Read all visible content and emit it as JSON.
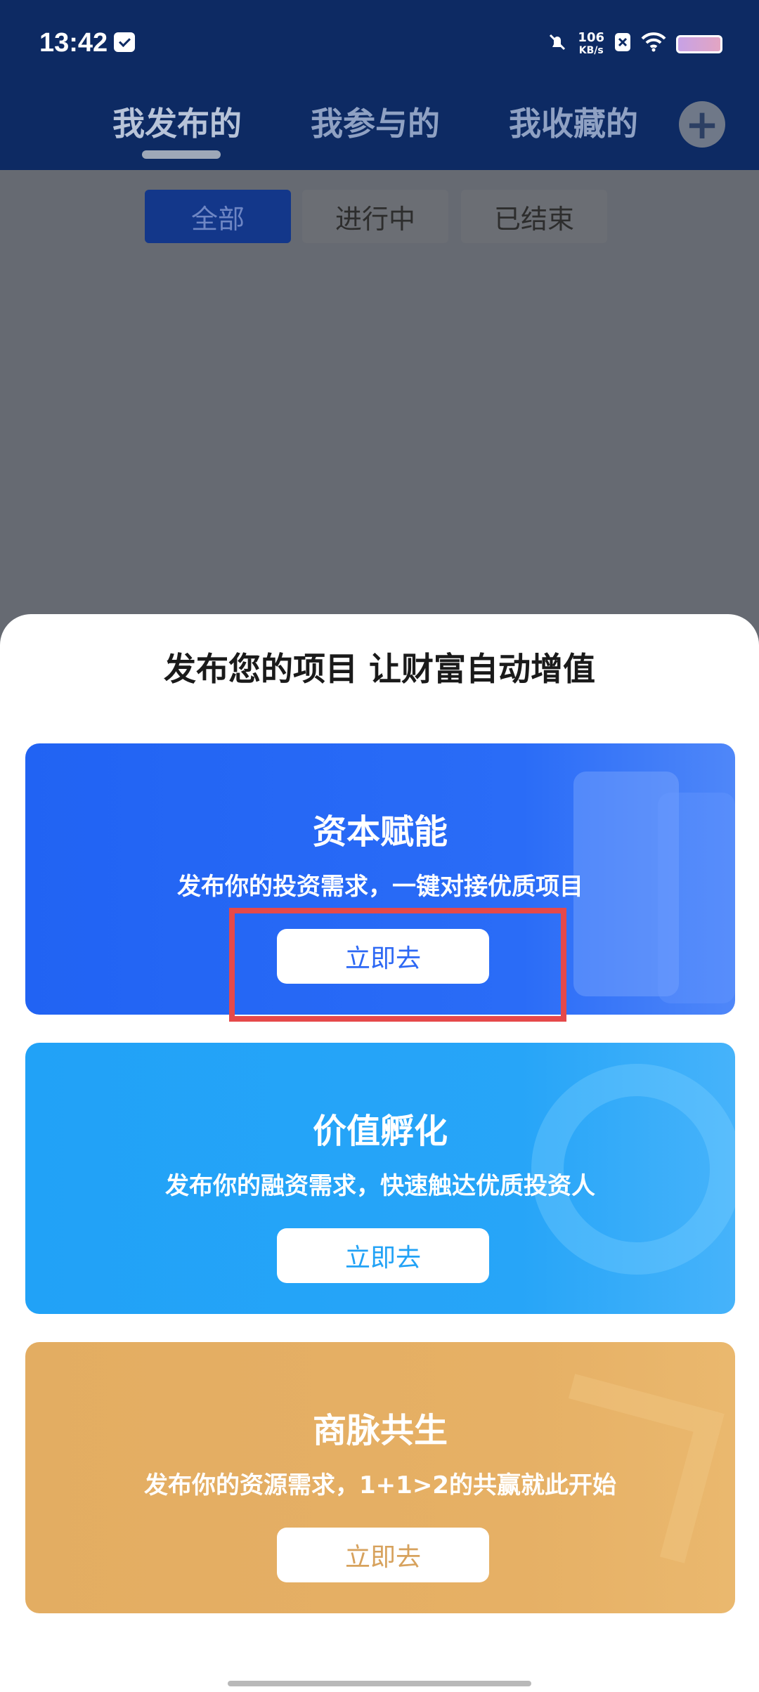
{
  "status_bar": {
    "time": "13:42",
    "net_speed": "106",
    "net_speed_unit": "KB/s",
    "icons": [
      "message-icon",
      "mute-bell-icon",
      "data-blocked-icon",
      "wifi-icon",
      "battery-icon"
    ]
  },
  "top_tabs": {
    "items": [
      {
        "label": "我发布的",
        "active": true
      },
      {
        "label": "我参与的",
        "active": false
      },
      {
        "label": "我收藏的",
        "active": false
      }
    ],
    "add_icon": "plus-icon"
  },
  "filters": {
    "items": [
      {
        "label": "全部",
        "active": true
      },
      {
        "label": "进行中",
        "active": false
      },
      {
        "label": "已结束",
        "active": false
      }
    ]
  },
  "sheet": {
    "title": "发布您的项目 让财富自动增值",
    "cards": [
      {
        "title": "资本赋能",
        "desc": "发布你的投资需求，一键对接优质项目",
        "button": "立即去",
        "color": "#2163f3"
      },
      {
        "title": "价值孵化",
        "desc": "发布你的融资需求，快速触达优质投资人",
        "button": "立即去",
        "color": "#21a2f7"
      },
      {
        "title": "商脉共生",
        "desc": "发布你的资源需求，1+1>2的共赢就此开始",
        "button": "立即去",
        "color": "#e3ad62"
      }
    ]
  },
  "colors": {
    "header_bg": "#0d2a63",
    "overlay": "#666a72",
    "highlight": "#e5494a"
  }
}
